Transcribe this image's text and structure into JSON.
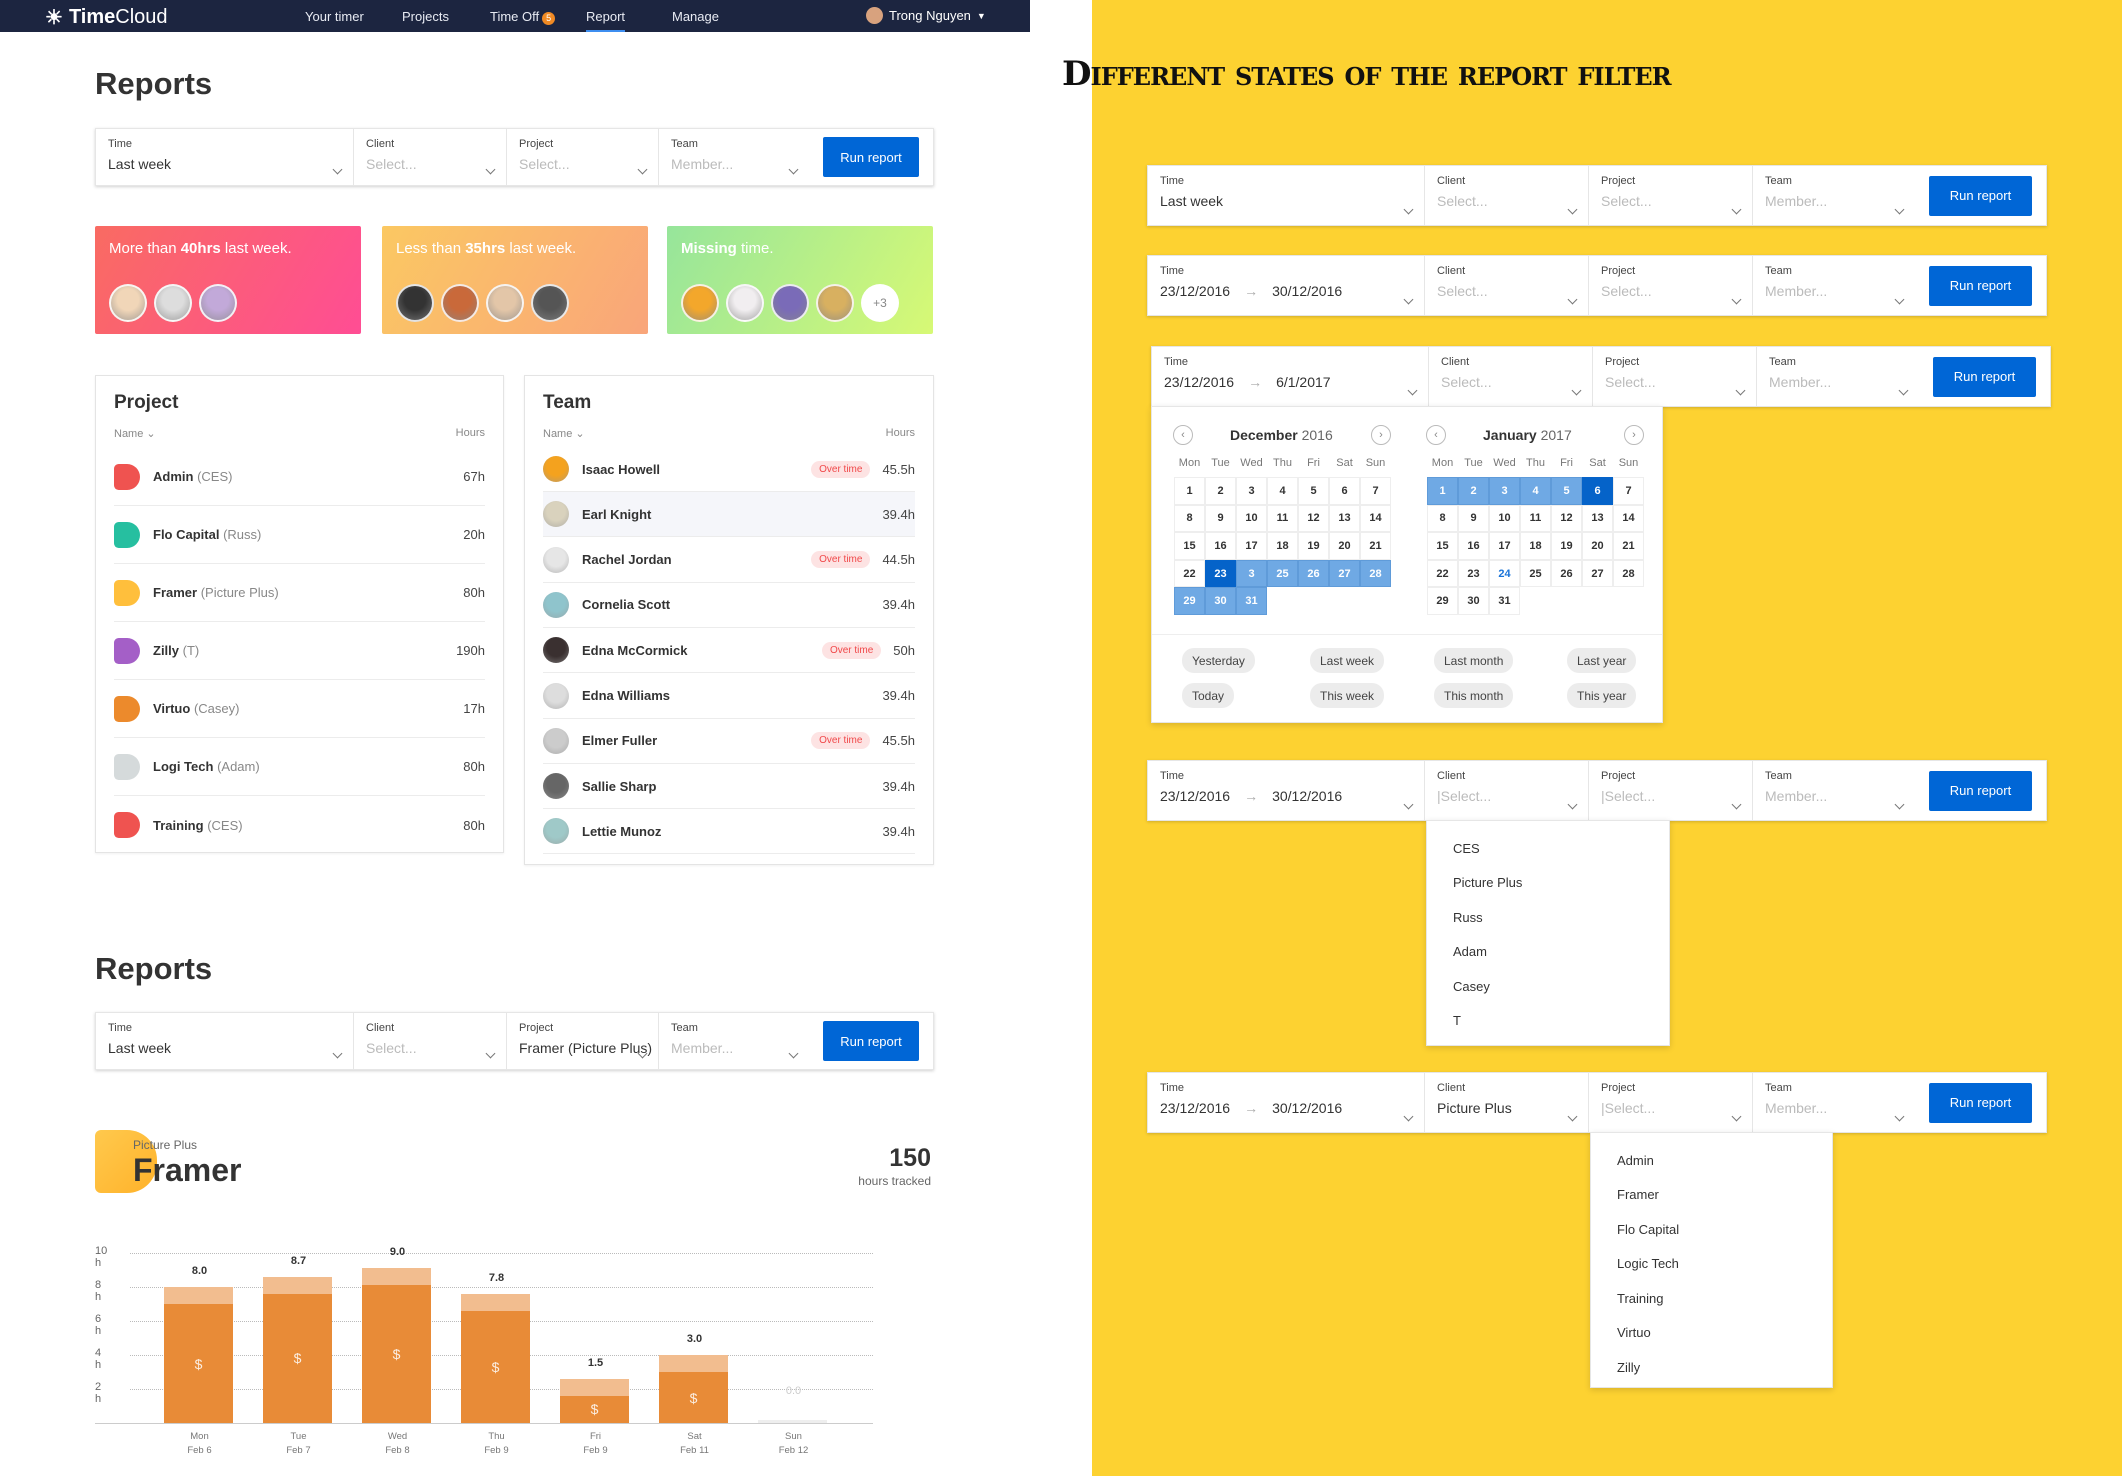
{
  "nav": {
    "logo": {
      "bold": "Time",
      "light": "Cloud"
    },
    "items": [
      {
        "label": "Your timer"
      },
      {
        "label": "Projects"
      },
      {
        "label": "Time Off",
        "badge": "5"
      },
      {
        "label": "Report",
        "active": true
      },
      {
        "label": "Manage"
      }
    ],
    "user": "Trong Nguyen"
  },
  "page_title": "Reports",
  "section_title": "Different states of the report filter",
  "filter_labels": {
    "time": "Time",
    "client": "Client",
    "project": "Project",
    "team": "Team",
    "run": "Run report"
  },
  "filters": {
    "main": {
      "time": [
        "Last week"
      ],
      "client": "Select...",
      "client_ph": true,
      "project": "Select...",
      "project_ph": true,
      "team": "Member...",
      "team_ph": true
    },
    "framer": {
      "time": [
        "Last week"
      ],
      "client": "Select...",
      "client_ph": true,
      "project": "Framer (Picture Plus)",
      "project_ph": false,
      "team": "Member...",
      "team_ph": true
    },
    "state1": {
      "time": [
        "Last week"
      ],
      "client": "Select...",
      "client_ph": true,
      "project": "Select...",
      "project_ph": true,
      "team": "Member...",
      "team_ph": true
    },
    "state2": {
      "time": [
        "23/12/2016",
        "30/12/2016"
      ],
      "client": "Select...",
      "client_ph": true,
      "project": "Select...",
      "project_ph": true,
      "team": "Member...",
      "team_ph": true
    },
    "state3": {
      "time": [
        "23/12/2016",
        "6/1/2017"
      ],
      "client": "Select...",
      "client_ph": true,
      "project": "Select...",
      "project_ph": true,
      "team": "Member...",
      "team_ph": true
    },
    "state4": {
      "time": [
        "23/12/2016",
        "30/12/2016"
      ],
      "client": "|Select...",
      "client_ph": true,
      "project": "|Select...",
      "project_ph": true,
      "team": "Member...",
      "team_ph": true
    },
    "state5": {
      "time": [
        "23/12/2016",
        "30/12/2016"
      ],
      "client": "Picture Plus",
      "client_ph": false,
      "project": "|Select...",
      "project_ph": true,
      "team": "Member...",
      "team_ph": true
    }
  },
  "cards": [
    {
      "pre": "More than ",
      "bold": "40hrs",
      "post": " last week.",
      "avatars": 3,
      "more": ""
    },
    {
      "pre": "Less than ",
      "bold": "35hrs",
      "post": " last week.",
      "avatars": 4,
      "more": ""
    },
    {
      "pre": "",
      "bold": "Missing",
      "post": " time.",
      "avatars": 4,
      "more": "+3"
    }
  ],
  "project_panel": {
    "title": "Project",
    "col_name": "Name",
    "col_hours": "Hours",
    "rows": [
      {
        "name": "Admin",
        "client": "(CES)",
        "hours": "67h",
        "color": "#ef5350"
      },
      {
        "name": "Flo Capital",
        "client": "(Russ)",
        "hours": "20h",
        "color": "#26bfa0"
      },
      {
        "name": "Framer",
        "client": "(Picture Plus)",
        "hours": "80h",
        "color": "#ffbf3c"
      },
      {
        "name": "Zilly",
        "client": "(T)",
        "hours": "190h",
        "color": "#a45fc7"
      },
      {
        "name": "Virtuo",
        "client": "(Casey)",
        "hours": "17h",
        "color": "#ec8a2c"
      },
      {
        "name": "Logi Tech",
        "client": "(Adam)",
        "hours": "80h",
        "color": "#d5dadb"
      },
      {
        "name": "Training",
        "client": "(CES)",
        "hours": "80h",
        "color": "#ef5350"
      }
    ]
  },
  "team_panel": {
    "title": "Team",
    "col_name": "Name",
    "col_hours": "Hours",
    "overtime_label": "Over time",
    "rows": [
      {
        "name": "Isaac Howell",
        "hours": "45.5h",
        "overtime": true
      },
      {
        "name": "Earl Knight",
        "hours": "39.4h",
        "overtime": false,
        "highlight": true
      },
      {
        "name": "Rachel Jordan",
        "hours": "44.5h",
        "overtime": true
      },
      {
        "name": "Cornelia Scott",
        "hours": "39.4h",
        "overtime": false
      },
      {
        "name": "Edna McCormick",
        "hours": "50h",
        "overtime": true
      },
      {
        "name": "Edna Williams",
        "hours": "39.4h",
        "overtime": false
      },
      {
        "name": "Elmer Fuller",
        "hours": "45.5h",
        "overtime": true
      },
      {
        "name": "Sallie Sharp",
        "hours": "39.4h",
        "overtime": false
      },
      {
        "name": "Lettie Munoz",
        "hours": "39.4h",
        "overtime": false
      }
    ]
  },
  "framer": {
    "client": "Picture Plus",
    "name": "Framer",
    "total": "150",
    "total_label": "hours tracked",
    "color": "#ffbf3c"
  },
  "chart_data": {
    "type": "bar",
    "stacked": true,
    "categories": [
      "Mon",
      "Tue",
      "Wed",
      "Thu",
      "Fri",
      "Sat",
      "Sun"
    ],
    "dates": [
      "Feb 6",
      "Feb 7",
      "Feb 8",
      "Feb 9",
      "Feb 9",
      "Feb 11",
      "Feb 12"
    ],
    "value_labels": [
      "8.0",
      "8.7",
      "9.0",
      "7.8",
      "1.5",
      "3.0",
      "0.0"
    ],
    "series": [
      {
        "values": [
          7.0,
          7.6,
          8.1,
          6.6,
          1.6,
          3.0,
          0
        ],
        "color": "#e88b37",
        "icon": "dollar"
      },
      {
        "values": [
          1.0,
          1.0,
          1.0,
          1.0,
          1.0,
          1.0,
          0
        ],
        "color": "#f2bd8f"
      }
    ],
    "yticks": [
      "2 h",
      "4 h",
      "6 h",
      "8 h",
      "10 h"
    ],
    "ylim": [
      0,
      10
    ],
    "grid": true
  },
  "calendar": {
    "left": {
      "month": "December",
      "year": "2016"
    },
    "right": {
      "month": "January",
      "year": "2017"
    },
    "weekdays": [
      "Mon",
      "Tue",
      "Wed",
      "Thu",
      "Fri",
      "Sat",
      "Sun"
    ],
    "left_days": [
      "1",
      "2",
      "3",
      "4",
      "5",
      "6",
      "7",
      "8",
      "9",
      "10",
      "11",
      "12",
      "13",
      "14",
      "15",
      "16",
      "17",
      "18",
      "19",
      "20",
      "21",
      "22",
      "23",
      "3",
      "25",
      "26",
      "27",
      "28",
      "29",
      "30",
      "31"
    ],
    "left_selected": [
      23
    ],
    "left_range_from": 24,
    "right_days": [
      "1",
      "2",
      "3",
      "4",
      "5",
      "6",
      "7",
      "8",
      "9",
      "10",
      "11",
      "12",
      "13",
      "14",
      "15",
      "16",
      "17",
      "18",
      "19",
      "20",
      "21",
      "22",
      "23",
      "24",
      "25",
      "26",
      "27",
      "28",
      "29",
      "30",
      "31"
    ],
    "right_selected": [
      6
    ],
    "right_range_to": 5,
    "right_today": 24,
    "quick": [
      [
        "Yesterday",
        "Last week",
        "Last month",
        "Last year"
      ],
      [
        "Today",
        "This week",
        "This month",
        "This year"
      ]
    ]
  },
  "client_options": [
    "CES",
    "Picture Plus",
    "Russ",
    "Adam",
    "Casey",
    "T"
  ],
  "project_options": [
    "Admin",
    "Framer",
    "Flo Capital",
    "Logic Tech",
    "Training",
    "Virtuo",
    "Zilly"
  ]
}
